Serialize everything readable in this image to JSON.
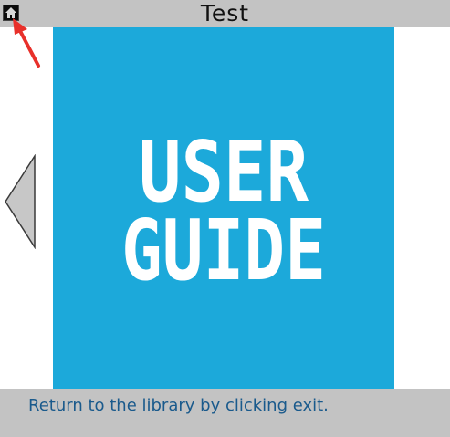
{
  "window": {
    "title": "Test"
  },
  "toolbar": {
    "exit_icon": "home-icon"
  },
  "cover": {
    "title_line_1": "USER",
    "title_line_2": "GUIDE",
    "background_color": "#1ca9da",
    "text_color": "#ffffff"
  },
  "navigation": {
    "previous_icon": "triangle-left-icon"
  },
  "footer": {
    "message": "Return to the library by clicking exit."
  },
  "annotation": {
    "pointer_icon": "red-arrow-icon",
    "color": "#e8302a"
  }
}
